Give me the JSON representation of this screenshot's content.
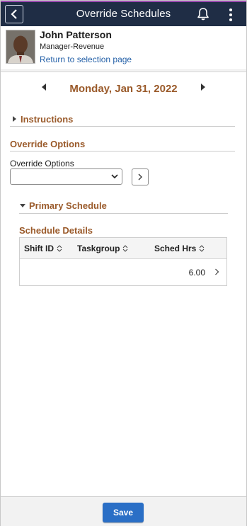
{
  "header": {
    "title": "Override Schedules"
  },
  "employee": {
    "name": "John Patterson",
    "role": "Manager-Revenue",
    "return_link": "Return to selection page"
  },
  "date_nav": {
    "date": "Monday, Jan 31, 2022"
  },
  "instructions": {
    "label": "Instructions",
    "expanded": false
  },
  "override": {
    "section_title": "Override Options",
    "field_label": "Override Options",
    "selected_value": ""
  },
  "primary_schedule": {
    "label": "Primary Schedule",
    "expanded": true,
    "details_title": "Schedule Details",
    "columns": [
      "Shift ID",
      "Taskgroup",
      "Sched Hrs"
    ],
    "rows": [
      {
        "shift_id": "",
        "taskgroup": "",
        "sched_hrs": "6.00"
      }
    ]
  },
  "footer": {
    "save_label": "Save"
  },
  "colors": {
    "header_bg": "#1f2d45",
    "accent_text": "#9a5a2a",
    "link": "#2561a8",
    "primary_button": "#2a6fc6"
  }
}
